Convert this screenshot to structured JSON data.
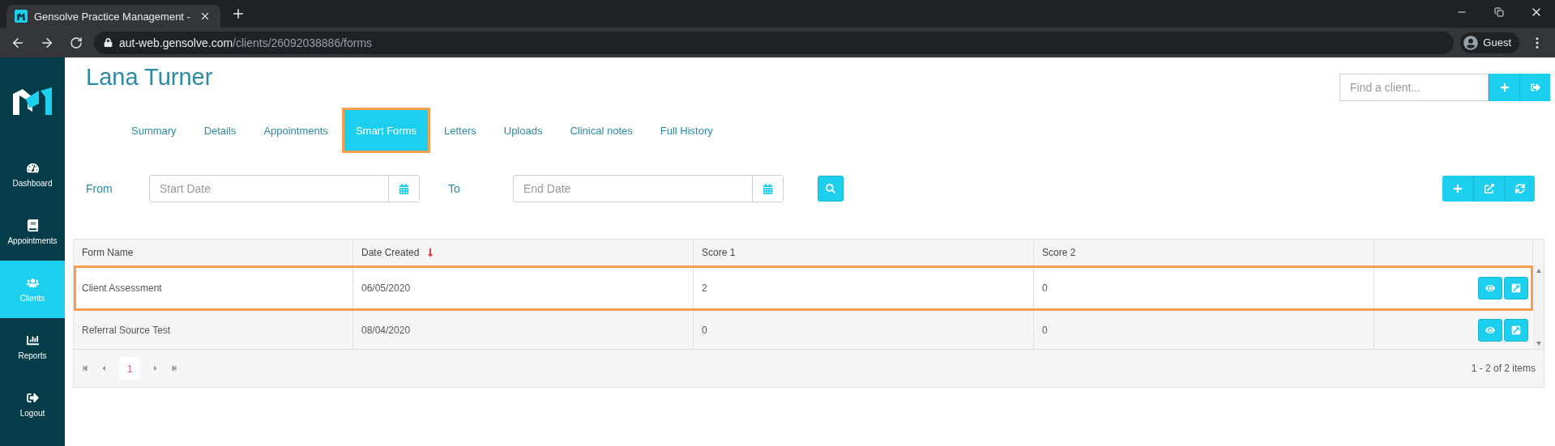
{
  "browser": {
    "tab_title": "Gensolve Practice Management -",
    "url_host": "aut-web.gensolve.com",
    "url_path": "/clients/26092038886/forms",
    "profile": "Guest"
  },
  "sidebar": {
    "items": [
      {
        "label": "Dashboard",
        "selected": false
      },
      {
        "label": "Appointments",
        "selected": false
      },
      {
        "label": "Clients",
        "selected": true
      },
      {
        "label": "Reports",
        "selected": false
      },
      {
        "label": "Logout",
        "selected": false
      }
    ]
  },
  "client_name": "Lana Turner",
  "client_search": {
    "placeholder": "Find a client..."
  },
  "tabs": [
    {
      "label": "Summary",
      "selected": false
    },
    {
      "label": "Details",
      "selected": false
    },
    {
      "label": "Appointments",
      "selected": false
    },
    {
      "label": "Smart Forms",
      "selected": true
    },
    {
      "label": "Letters",
      "selected": false
    },
    {
      "label": "Uploads",
      "selected": false
    },
    {
      "label": "Clinical notes",
      "selected": false
    },
    {
      "label": "Full History",
      "selected": false
    }
  ],
  "filter": {
    "from_label": "From",
    "start": {
      "placeholder": "Start Date"
    },
    "to_label": "To",
    "end": {
      "placeholder": "End Date"
    }
  },
  "table": {
    "columns": [
      {
        "label": "Form Name",
        "sorted_descending": false
      },
      {
        "label": "Date Created",
        "sorted_descending": true
      },
      {
        "label": "Score 1",
        "sorted_descending": false
      },
      {
        "label": "Score 2",
        "sorted_descending": false
      }
    ],
    "rows": [
      {
        "cells": [
          "Client Assessment",
          "06/05/2020",
          "2",
          "0"
        ],
        "selected": true
      },
      {
        "cells": [
          "Referral Source Test",
          "08/04/2020",
          "0",
          "0"
        ],
        "selected": false
      }
    ],
    "pages": [
      {
        "label": "1",
        "selected": true
      }
    ],
    "summary": "1 - 2 of 2 items"
  }
}
